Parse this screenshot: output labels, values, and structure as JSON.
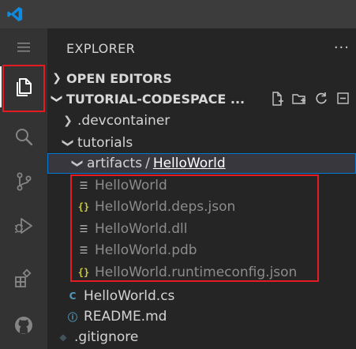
{
  "colors": {
    "titlebar": "#3c3c3c",
    "activitybar": "#333333",
    "sidebar": "#252526",
    "highlight_box": "#e51b24",
    "selected_row": "#37373d"
  },
  "activity_bar": {
    "items": [
      "menu-icon",
      "explorer-icon",
      "search-icon",
      "source-control-icon",
      "run-debug-icon",
      "extensions-icon",
      "github-icon"
    ]
  },
  "sidebar": {
    "title": "EXPLORER",
    "more": "···",
    "sections": {
      "open_editors": "OPEN EDITORS",
      "workspace": "TUTORIAL-CODESPACE ..."
    },
    "tree": {
      "devcontainer": ".devcontainer",
      "tutorials": "tutorials",
      "artifacts": "artifacts",
      "separator": "/",
      "helloworld_folder": "HelloWorld",
      "files": [
        {
          "name": "HelloWorld",
          "icon": "lines-icon"
        },
        {
          "name": "HelloWorld.deps.json",
          "icon": "json-icon"
        },
        {
          "name": "HelloWorld.dll",
          "icon": "lines-icon"
        },
        {
          "name": "HelloWorld.pdb",
          "icon": "lines-icon"
        },
        {
          "name": "HelloWorld.runtimeconfig.json",
          "icon": "json-icon"
        }
      ],
      "cs_file": "HelloWorld.cs",
      "readme": "README.md",
      "gitignore": ".gitignore"
    }
  }
}
